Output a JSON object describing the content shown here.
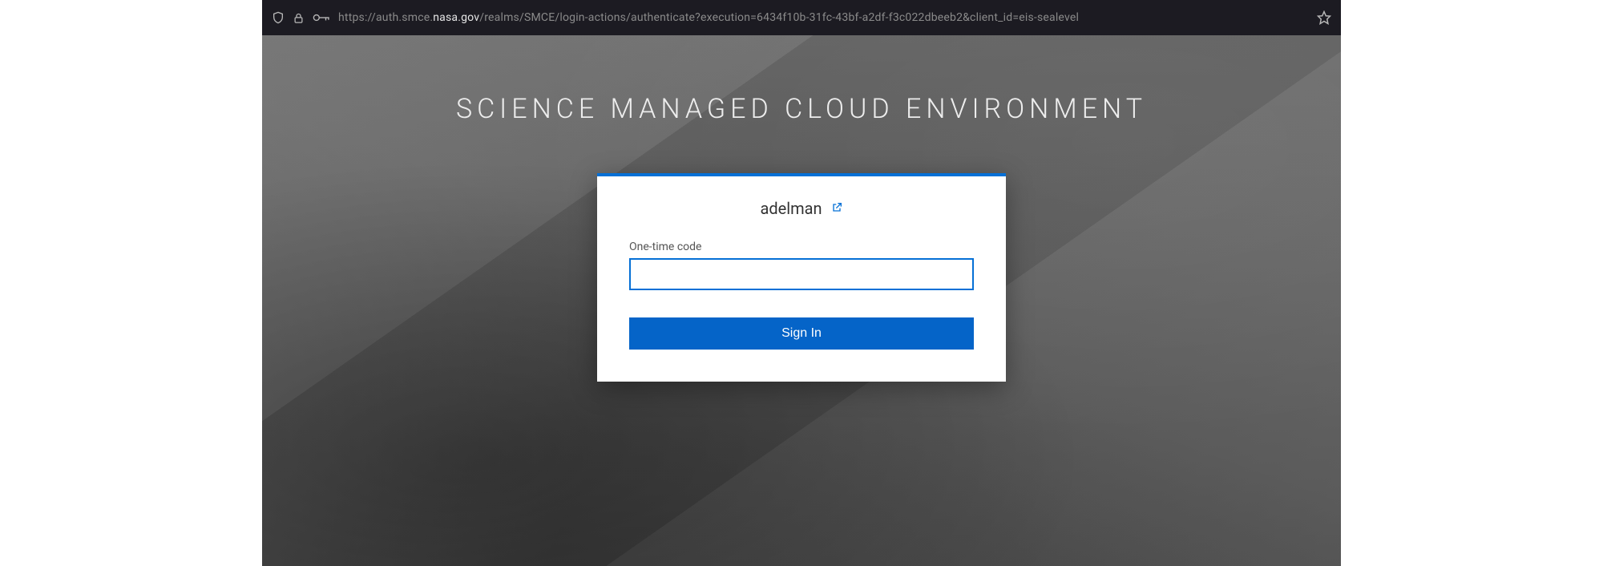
{
  "url": {
    "prefix": "https://auth.smce.",
    "domain": "nasa.gov",
    "suffix": "/realms/SMCE/login-actions/authenticate?execution=6434f10b-31fc-43bf-a2df-f3c022dbeeb2&client_id=eis-sealevel"
  },
  "page": {
    "title": "SCIENCE MANAGED CLOUD ENVIRONMENT"
  },
  "login": {
    "username": "adelman",
    "otp_label": "One-time code",
    "otp_value": "",
    "signin_label": "Sign In"
  },
  "colors": {
    "accent": "#0570d6"
  }
}
